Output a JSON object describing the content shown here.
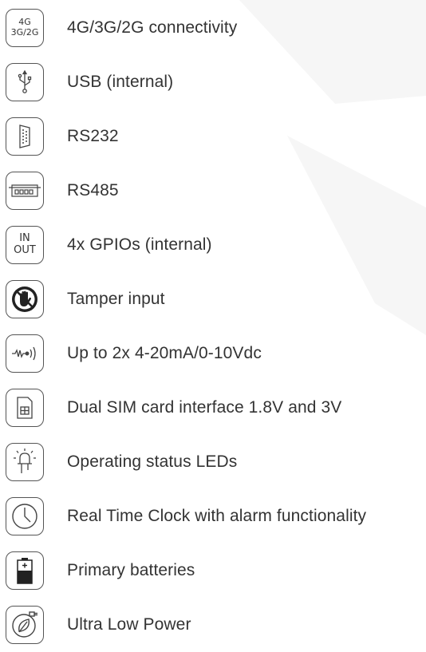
{
  "features": [
    {
      "icon": "network-4g-3g-2g-icon",
      "icon_text": [
        "4G",
        "3G/2G"
      ],
      "label": "4G/3G/2G connectivity"
    },
    {
      "icon": "usb-icon",
      "label": "USB (internal)"
    },
    {
      "icon": "rs232-port-icon",
      "label": "RS232"
    },
    {
      "icon": "rs485-port-icon",
      "label": "RS485"
    },
    {
      "icon": "in-out-icon",
      "icon_text": [
        "IN",
        "OUT"
      ],
      "label": "4x GPIOs (internal)"
    },
    {
      "icon": "tamper-hand-icon",
      "label": "Tamper input"
    },
    {
      "icon": "analog-signal-icon",
      "label": "Up to 2x 4-20mA/0-10Vdc"
    },
    {
      "icon": "sim-card-icon",
      "label": "Dual SIM card interface 1.8V and 3V"
    },
    {
      "icon": "led-icon",
      "label": "Operating status LEDs"
    },
    {
      "icon": "clock-icon",
      "label": "Real Time Clock with alarm functionality"
    },
    {
      "icon": "battery-icon",
      "label": "Primary batteries"
    },
    {
      "icon": "low-power-leaf-icon",
      "label": "Ultra Low Power"
    }
  ]
}
